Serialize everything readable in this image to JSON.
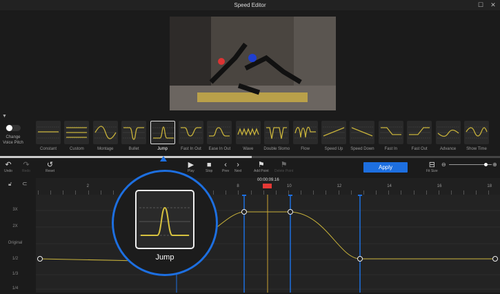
{
  "window": {
    "title": "Speed Editor"
  },
  "voice_pitch": {
    "label_line1": "Change",
    "label_line2": "Voice Pitch",
    "enabled": false
  },
  "presets": [
    {
      "label": "Constant"
    },
    {
      "label": "Custom"
    },
    {
      "label": "Montage"
    },
    {
      "label": "Bullet"
    },
    {
      "label": "Jump",
      "selected": true
    },
    {
      "label": "Fast In Out"
    },
    {
      "label": "Ease In Out"
    },
    {
      "label": "Wave"
    },
    {
      "label": "Double Slomo"
    },
    {
      "label": "Flow"
    },
    {
      "label": "Speed Up"
    },
    {
      "label": "Speed Down"
    },
    {
      "label": "Fast In"
    },
    {
      "label": "Fast Out"
    },
    {
      "label": "Advance"
    },
    {
      "label": "Show Time"
    }
  ],
  "toolbar": {
    "undo": "Undo",
    "redo": "Redo",
    "reset": "Reset",
    "play": "Play",
    "stop": "Stop",
    "prev": "Prev",
    "next": "Next",
    "add_point": "Add Point",
    "delete_point": "Delete Point",
    "apply": "Apply",
    "fit_size": "Fit Size",
    "zoom_level": 0.85
  },
  "timeline": {
    "playhead_time": "00:00:09.16",
    "ticks": [
      "2",
      "8",
      "10",
      "12",
      "14",
      "16",
      "18"
    ]
  },
  "graph": {
    "speed_labels": [
      "3X",
      "2X",
      "Original",
      "1/2",
      "1/3",
      "1/4"
    ]
  },
  "magnifier": {
    "label": "Jump"
  },
  "colors": {
    "accent": "#1d6fe0",
    "curve": "#c8b23a",
    "playhead": "#e53935"
  }
}
